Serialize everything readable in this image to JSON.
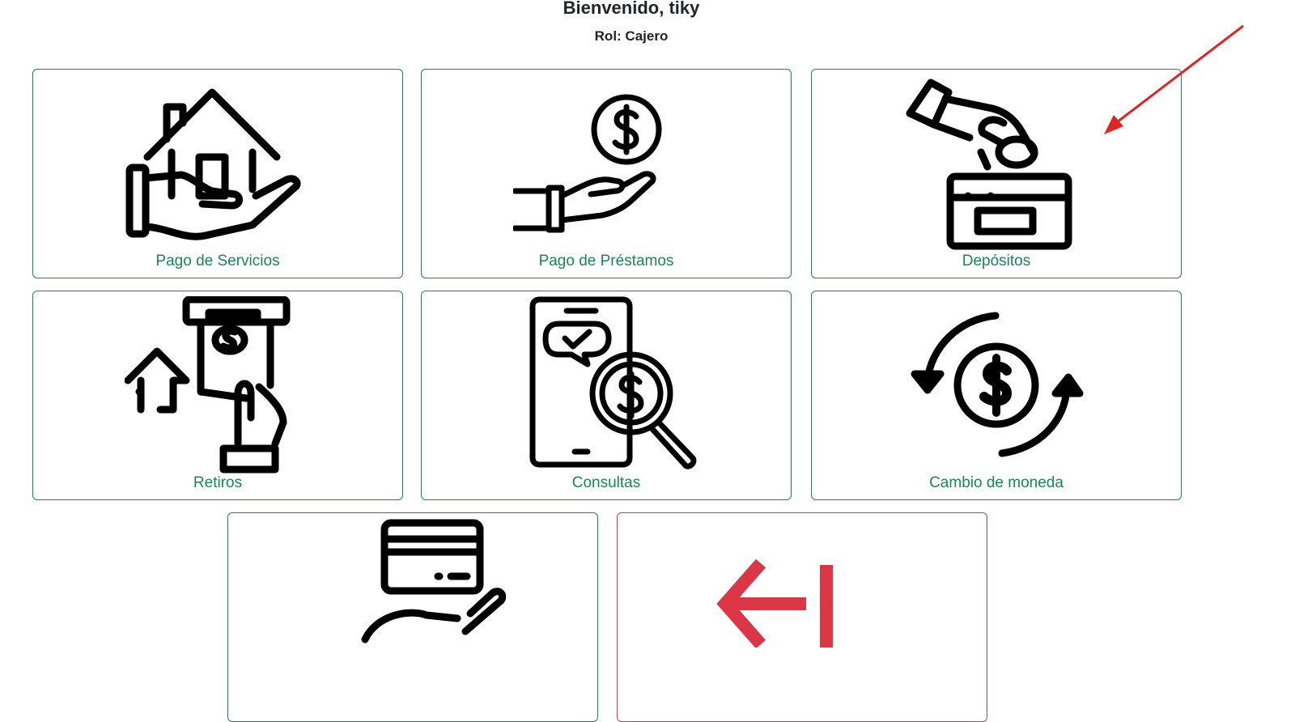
{
  "header": {
    "welcome": "Bienvenido, tiky",
    "role": "Rol: Cajero"
  },
  "options": [
    {
      "label": "Pago de Servicios",
      "icon": "house-in-hand-icon"
    },
    {
      "label": "Pago de Préstamos",
      "icon": "coin-in-hand-icon"
    },
    {
      "label": "Depósitos",
      "icon": "deposit-coin-box-icon"
    },
    {
      "label": "Retiros",
      "icon": "atm-withdraw-icon"
    },
    {
      "label": "Consultas",
      "icon": "phone-search-dollar-icon"
    },
    {
      "label": "Cambio de moneda",
      "icon": "currency-exchange-icon"
    },
    {
      "label": "",
      "icon": "card-payment-hand-icon"
    },
    {
      "label": "",
      "icon": "logout-arrow-icon"
    }
  ],
  "colors": {
    "accent": "#198754",
    "danger": "#dc3545",
    "annotation": "#e02424"
  }
}
